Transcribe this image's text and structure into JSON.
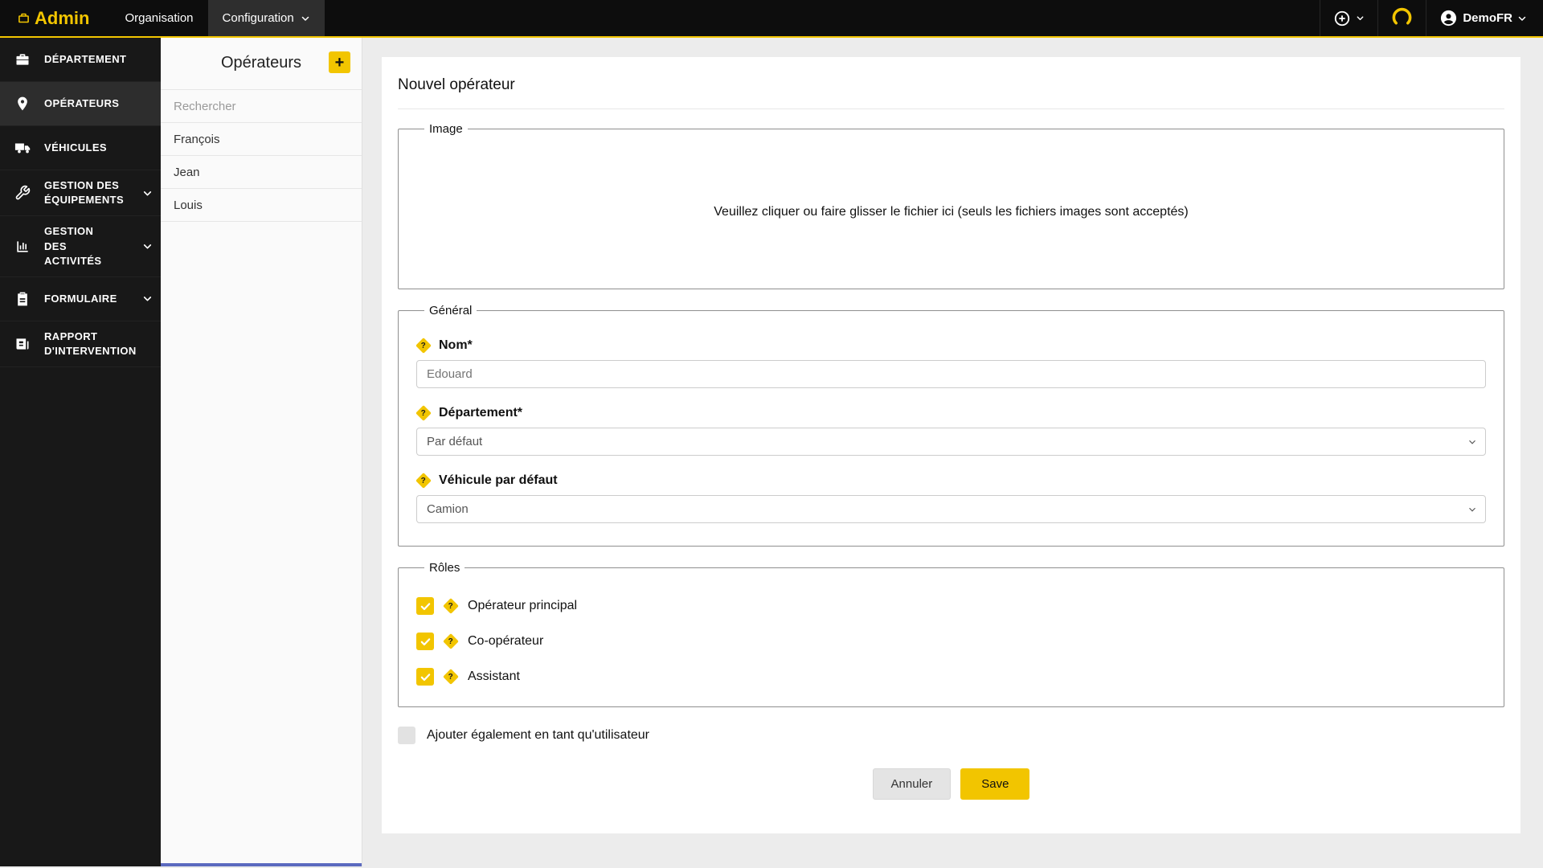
{
  "colors": {
    "accent": "#f2c500"
  },
  "icons": {
    "help": "?"
  },
  "topbar": {
    "logo": "Admin",
    "menu": [
      {
        "label": "Organisation"
      },
      {
        "label": "Configuration"
      }
    ],
    "user": {
      "name": "DemoFR"
    }
  },
  "sidebar": {
    "items": [
      {
        "label": "DÉPARTEMENT"
      },
      {
        "label": "OPÉRATEURS"
      },
      {
        "label": "VÉHICULES"
      },
      {
        "label": "GESTION DES ÉQUIPEMENTS"
      },
      {
        "label": "GESTION DES ACTIVITÉS"
      },
      {
        "label": "FORMULAIRE"
      },
      {
        "label": "RAPPORT D'INTERVENTION"
      }
    ]
  },
  "panel": {
    "title": "Opérateurs",
    "add_button": "+",
    "search_placeholder": "Rechercher",
    "items": [
      {
        "name": "François"
      },
      {
        "name": "Jean"
      },
      {
        "name": "Louis"
      }
    ]
  },
  "form": {
    "title": "Nouvel opérateur",
    "image": {
      "legend": "Image",
      "dropzone": "Veuillez cliquer ou faire glisser le fichier ici (seuls les fichiers images sont acceptés)"
    },
    "general": {
      "legend": "Général",
      "nom": {
        "label": "Nom*",
        "value": "Edouard"
      },
      "departement": {
        "label": "Département*",
        "value": "Par défaut"
      },
      "vehicule": {
        "label": "Véhicule par défaut",
        "value": "Camion"
      }
    },
    "roles": {
      "legend": "Rôles",
      "items": [
        {
          "label": "Opérateur principal",
          "checked": true
        },
        {
          "label": "Co-opérateur",
          "checked": true
        },
        {
          "label": "Assistant",
          "checked": true
        }
      ]
    },
    "add_user": {
      "label": "Ajouter également en tant qu'utilisateur",
      "checked": false
    },
    "actions": {
      "cancel": "Annuler",
      "save": "Save"
    }
  }
}
